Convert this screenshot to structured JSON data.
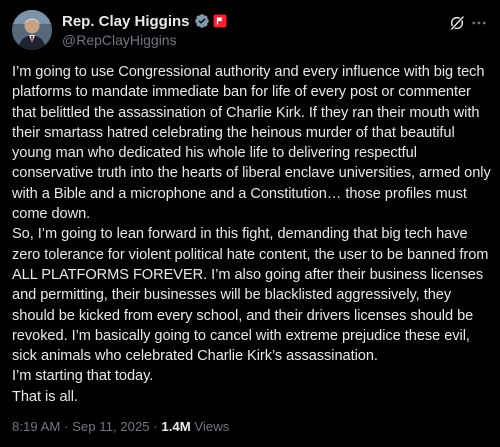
{
  "author": {
    "display_name": "Rep. Clay Higgins",
    "handle": "@RepClayHiggins",
    "verified_badge": "verified-gray-check-icon",
    "flag_badge": "red-flag-icon"
  },
  "post": {
    "text": "I’m going to use Congressional authority and every influence with big tech platforms to mandate immediate ban for life of every post or commenter that belittled the assassination of Charlie Kirk. If they ran their mouth with their smartass hatred celebrating the heinous murder of that beautiful young man who dedicated his whole life to delivering respectful conservative truth into the hearts of liberal enclave universities, armed only with a Bible and a microphone and a Constitution… those profiles must come down.\n  So, I’m going to lean forward in this fight, demanding that big tech have zero tolerance for violent political hate content, the user to be banned from ALL PLATFORMS FOREVER. I’m also going after their business licenses and permitting, their businesses will be blacklisted aggressively, they should be kicked from every school, and their drivers  licenses should be revoked. I’m basically going to cancel with extreme prejudice these evil, sick animals who celebrated Charlie Kirk’s assassination.\n   I’m starting that today.\n   That is all.",
    "time": "8:19 AM",
    "separator": "·",
    "date": "Sep 11, 2025",
    "views_count": "1.4M",
    "views_label": "Views"
  },
  "colors": {
    "background": "#000000",
    "primary_text": "#e7e9ea",
    "secondary_text": "#71767b",
    "badge_red": "#f4212e"
  },
  "icons": {
    "grok": "grok-icon",
    "more": "more-options-icon"
  }
}
